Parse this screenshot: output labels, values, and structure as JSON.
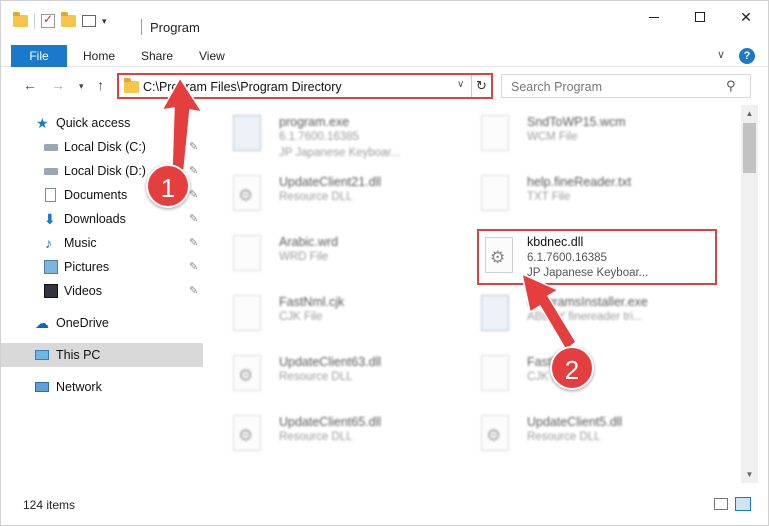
{
  "window": {
    "title": "Program",
    "buttons": {
      "minimize": "minimize",
      "maximize": "maximize",
      "close": "✕"
    }
  },
  "ribbon": {
    "tabs": [
      "File",
      "Home",
      "Share",
      "View"
    ],
    "help": "?"
  },
  "navbar": {
    "address": "C:\\Program Files\\Program Directory",
    "search_placeholder": "Search Program"
  },
  "sidebar": {
    "items": [
      {
        "label": "Quick access",
        "icon": "star-icon"
      },
      {
        "label": "Local Disk (C:)",
        "icon": "disk-icon",
        "pinned": true
      },
      {
        "label": "Local Disk (D:)",
        "icon": "disk-icon",
        "pinned": true
      },
      {
        "label": "Documents",
        "icon": "documents-icon",
        "pinned": true
      },
      {
        "label": "Downloads",
        "icon": "downloads-icon",
        "pinned": true
      },
      {
        "label": "Music",
        "icon": "music-icon",
        "pinned": true
      },
      {
        "label": "Pictures",
        "icon": "pictures-icon",
        "pinned": true
      },
      {
        "label": "Videos",
        "icon": "videos-icon",
        "pinned": true
      },
      {
        "label": "OneDrive",
        "icon": "onedrive-icon"
      },
      {
        "label": "This PC",
        "icon": "pc-icon",
        "selected": true
      },
      {
        "label": "Network",
        "icon": "network-icon"
      }
    ]
  },
  "files": [
    {
      "name": "program.exe",
      "line2": "6.1.7600.16385",
      "line3": "JP Japanese Keyboar...",
      "type": "exe"
    },
    {
      "name": "SndToWP15.wcm",
      "line2": "WCM File",
      "line3": "",
      "type": "doc"
    },
    {
      "name": "UpdateClient21.dll",
      "line2": "Resource DLL",
      "line3": "",
      "type": "dll"
    },
    {
      "name": "help.fineReader.txt",
      "line2": "TXT File",
      "line3": "",
      "type": "doc"
    },
    {
      "name": "Arabic.wrd",
      "line2": "WRD File",
      "line3": "",
      "type": "doc"
    },
    {
      "name": "kbdnec.dll",
      "line2": "6.1.7600.16385",
      "line3": "JP Japanese Keyboar...",
      "type": "dll",
      "highlight": true
    },
    {
      "name": "FastNml.cjk",
      "line2": "CJK File",
      "line3": "",
      "type": "doc"
    },
    {
      "name": "ProgramsInstaller.exe",
      "line2": "ABBYY finereader tri...",
      "line3": "",
      "type": "exe"
    },
    {
      "name": "UpdateClient63.dll",
      "line2": "Resource DLL",
      "line3": "",
      "type": "dll"
    },
    {
      "name": "FastRn.cjk",
      "line2": "CJK File",
      "line3": "",
      "type": "doc"
    },
    {
      "name": "UpdateClient65.dll",
      "line2": "Resource DLL",
      "line3": "",
      "type": "dll"
    },
    {
      "name": "UpdateClient5.dll",
      "line2": "Resource DLL",
      "line3": "",
      "type": "dll"
    }
  ],
  "status": {
    "items_count": "124 items"
  },
  "annotations": {
    "badge1": "1",
    "badge2": "2",
    "color": "#e53e3e"
  },
  "colors": {
    "accent": "#1979ca",
    "highlight": "#e53e3e"
  }
}
